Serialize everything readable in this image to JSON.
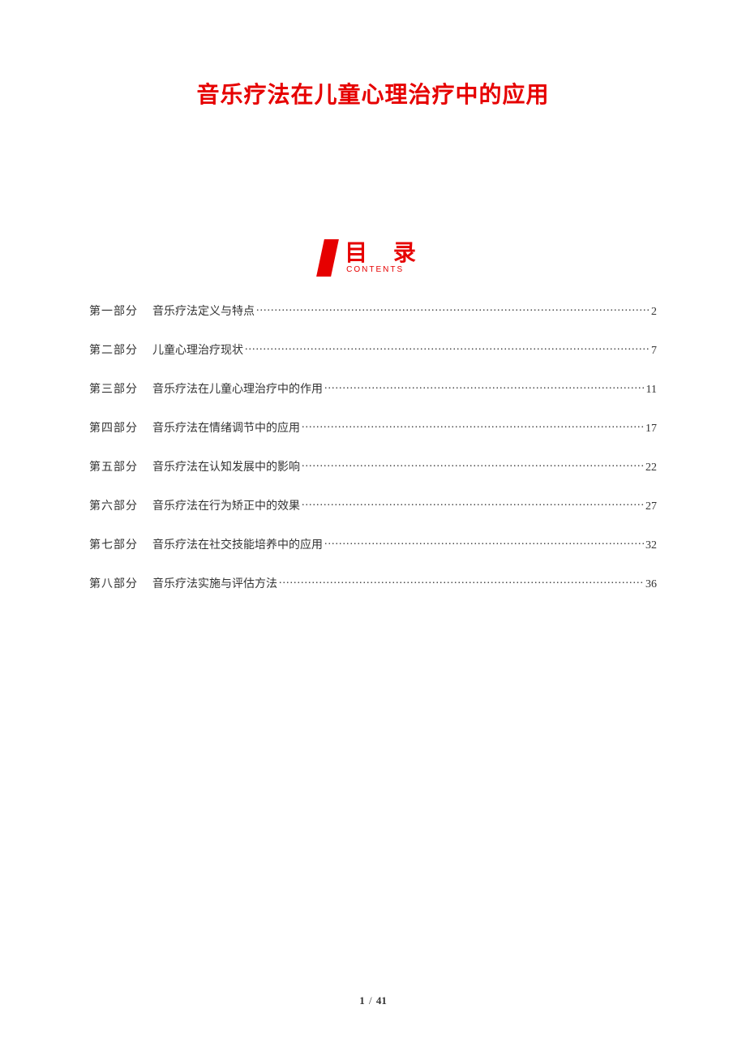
{
  "title": "音乐疗法在儿童心理治疗中的应用",
  "toc_label_cn": "目 录",
  "toc_label_en": "CONTENTS",
  "toc": [
    {
      "part": "第一部分",
      "name": "音乐疗法定义与特点",
      "page": "2"
    },
    {
      "part": "第二部分",
      "name": "儿童心理治疗现状",
      "page": "7"
    },
    {
      "part": "第三部分",
      "name": "音乐疗法在儿童心理治疗中的作用",
      "page": "11"
    },
    {
      "part": "第四部分",
      "name": "音乐疗法在情绪调节中的应用",
      "page": "17"
    },
    {
      "part": "第五部分",
      "name": "音乐疗法在认知发展中的影响",
      "page": "22"
    },
    {
      "part": "第六部分",
      "name": "音乐疗法在行为矫正中的效果",
      "page": "27"
    },
    {
      "part": "第七部分",
      "name": "音乐疗法在社交技能培养中的应用",
      "page": "32"
    },
    {
      "part": "第八部分",
      "name": "音乐疗法实施与评估方法",
      "page": "36"
    }
  ],
  "footer": {
    "current": "1",
    "sep": "/",
    "total": "41"
  }
}
